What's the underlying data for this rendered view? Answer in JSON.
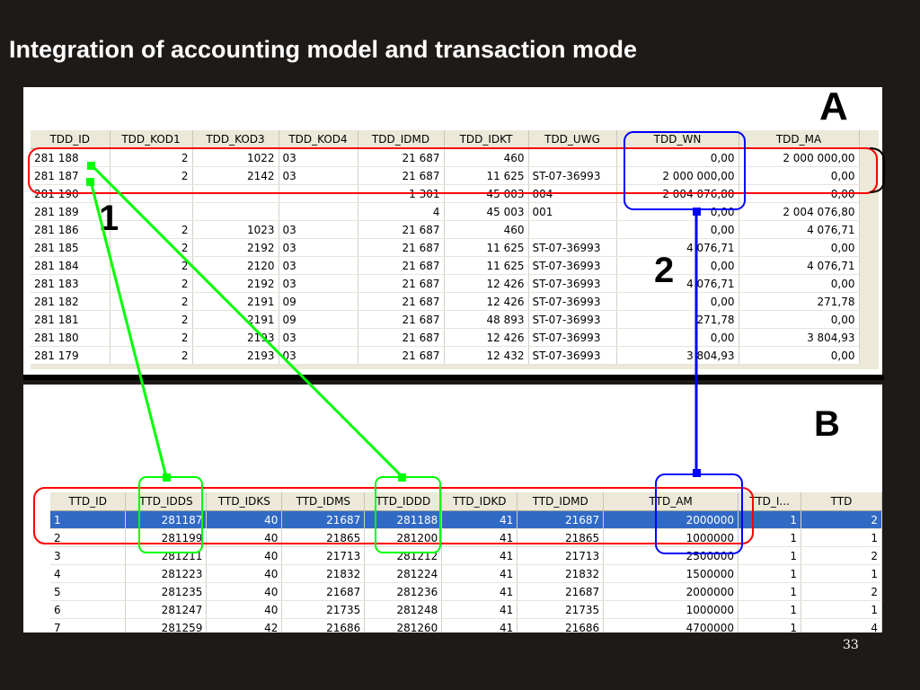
{
  "slide": {
    "title": "Integration of accounting model and transaction mode",
    "page_number": "33"
  },
  "labels": {
    "panel_a": "A",
    "panel_b": "B",
    "marker_1": "1",
    "marker_2": "2"
  },
  "colors": {
    "background": "#1e1a17",
    "red_highlight": "#ff0000",
    "blue_highlight": "#0000ff",
    "green_highlight": "#00ff00",
    "selection": "#316ac5"
  },
  "table_a": {
    "columns": [
      "TDD_ID",
      "TDD_KOD1",
      "TDD_KOD3",
      "TDD_KOD4",
      "TDD_IDMD",
      "TDD_IDKT",
      "TDD_UWG",
      "TDD_WN",
      "TDD_MA"
    ],
    "rows": [
      [
        "281 188",
        "2",
        "1022",
        "03",
        "21 687",
        "460",
        "",
        "0,00",
        "2 000 000,00"
      ],
      [
        "281 187",
        "2",
        "2142",
        "03",
        "21 687",
        "11 625",
        "ST-07-36993",
        "2 000 000,00",
        "0,00"
      ],
      [
        "281 190",
        "",
        "",
        "",
        "1 301",
        "45 003",
        "004",
        "2 004 076,80",
        "0,00"
      ],
      [
        "281 189",
        "",
        "",
        "",
        "4",
        "45 003",
        "001",
        "0,00",
        "2 004 076,80"
      ],
      [
        "281 186",
        "2",
        "1023",
        "03",
        "21 687",
        "460",
        "",
        "0,00",
        "4 076,71"
      ],
      [
        "281 185",
        "2",
        "2192",
        "03",
        "21 687",
        "11 625",
        "ST-07-36993",
        "4 076,71",
        "0,00"
      ],
      [
        "281 184",
        "2",
        "2120",
        "03",
        "21 687",
        "11 625",
        "ST-07-36993",
        "0,00",
        "4 076,71"
      ],
      [
        "281 183",
        "2",
        "2192",
        "03",
        "21 687",
        "12 426",
        "ST-07-36993",
        "4 076,71",
        "0,00"
      ],
      [
        "281 182",
        "2",
        "2191",
        "09",
        "21 687",
        "12 426",
        "ST-07-36993",
        "0,00",
        "271,78"
      ],
      [
        "281 181",
        "2",
        "2191",
        "09",
        "21 687",
        "48 893",
        "ST-07-36993",
        "271,78",
        "0,00"
      ],
      [
        "281 180",
        "2",
        "2193",
        "03",
        "21 687",
        "12 426",
        "ST-07-36993",
        "0,00",
        "3 804,93"
      ],
      [
        "281 179",
        "2",
        "2193",
        "03",
        "21 687",
        "12 432",
        "ST-07-36993",
        "3 804,93",
        "0,00"
      ]
    ]
  },
  "table_b": {
    "columns": [
      "TTD_ID",
      "TTD_IDDS",
      "TTD_IDKS",
      "TTD_IDMS",
      "TTD_IDDD",
      "TTD_IDKD",
      "TTD_IDMD",
      "TTD_AM",
      "TTD_I...",
      "TTD"
    ],
    "rows": [
      [
        "1",
        "281187",
        "40",
        "21687",
        "281188",
        "41",
        "21687",
        "2000000",
        "1",
        "2"
      ],
      [
        "2",
        "281199",
        "40",
        "21865",
        "281200",
        "41",
        "21865",
        "1000000",
        "1",
        "1"
      ],
      [
        "3",
        "281211",
        "40",
        "21713",
        "281212",
        "41",
        "21713",
        "2500000",
        "1",
        "2"
      ],
      [
        "4",
        "281223",
        "40",
        "21832",
        "281224",
        "41",
        "21832",
        "1500000",
        "1",
        "1"
      ],
      [
        "5",
        "281235",
        "40",
        "21687",
        "281236",
        "41",
        "21687",
        "2000000",
        "1",
        "2"
      ],
      [
        "6",
        "281247",
        "40",
        "21735",
        "281248",
        "41",
        "21735",
        "1000000",
        "1",
        "1"
      ],
      [
        "7",
        "281259",
        "42",
        "21686",
        "281260",
        "41",
        "21686",
        "4700000",
        "1",
        "4"
      ]
    ]
  }
}
